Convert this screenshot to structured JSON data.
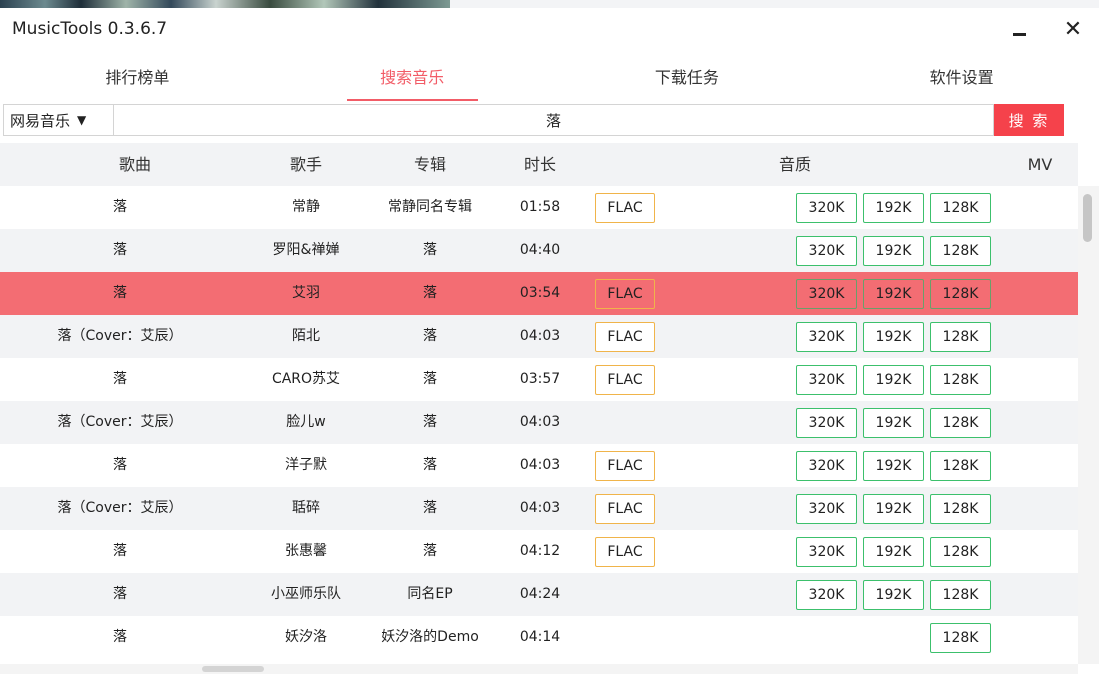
{
  "window": {
    "title": "MusicTools 0.3.6.7"
  },
  "tabs": [
    "排行榜单",
    "搜索音乐",
    "下载任务",
    "软件设置"
  ],
  "active_tab": 1,
  "search": {
    "source": "网易音乐",
    "query": "落",
    "button": "搜 索"
  },
  "columns": {
    "song": "歌曲",
    "artist": "歌手",
    "album": "专辑",
    "duration": "时长",
    "quality": "音质",
    "mv": "MV"
  },
  "quality_labels": {
    "flac": "FLAC",
    "q320": "320K",
    "q192": "192K",
    "q128": "128K"
  },
  "rows": [
    {
      "song": "落",
      "artist": "常静",
      "album": "常静同名专辑",
      "duration": "01:58",
      "flac": true,
      "q320": true,
      "q192": true,
      "q128": true
    },
    {
      "song": "落",
      "artist": "罗阳&禅婵",
      "album": "落",
      "duration": "04:40",
      "flac": false,
      "q320": true,
      "q192": true,
      "q128": true
    },
    {
      "song": "落",
      "artist": "艾羽",
      "album": "落",
      "duration": "03:54",
      "flac": true,
      "q320": true,
      "q192": true,
      "q128": true,
      "selected": true
    },
    {
      "song": "落（Cover：艾辰）",
      "artist": "陌北",
      "album": "落",
      "duration": "04:03",
      "flac": true,
      "q320": true,
      "q192": true,
      "q128": true
    },
    {
      "song": "落",
      "artist": "CARO苏艾",
      "album": "落",
      "duration": "03:57",
      "flac": true,
      "q320": true,
      "q192": true,
      "q128": true
    },
    {
      "song": "落（Cover：艾辰）",
      "artist": "脸儿w",
      "album": "落",
      "duration": "04:03",
      "flac": false,
      "q320": true,
      "q192": true,
      "q128": true
    },
    {
      "song": "落",
      "artist": "洋子默",
      "album": "落",
      "duration": "04:03",
      "flac": true,
      "q320": true,
      "q192": true,
      "q128": true
    },
    {
      "song": "落（Cover：艾辰）",
      "artist": "聒碎",
      "album": "落",
      "duration": "04:03",
      "flac": true,
      "q320": true,
      "q192": true,
      "q128": true
    },
    {
      "song": "落",
      "artist": "张惠馨",
      "album": "落",
      "duration": "04:12",
      "flac": true,
      "q320": true,
      "q192": true,
      "q128": true
    },
    {
      "song": "落",
      "artist": "小巫师乐队",
      "album": "同名EP",
      "duration": "04:24",
      "flac": false,
      "q320": true,
      "q192": true,
      "q128": true
    },
    {
      "song": "落",
      "artist": "妖汐洛",
      "album": "妖汐洛的Demo",
      "duration": "04:14",
      "flac": false,
      "q320": false,
      "q192": false,
      "q128": true
    }
  ],
  "colors": {
    "accent": "#f25c67",
    "search_button": "#f5424b",
    "selected_row": "#f36d73",
    "flac_border": "#f0b44a",
    "quality_border": "#3cc06c"
  }
}
